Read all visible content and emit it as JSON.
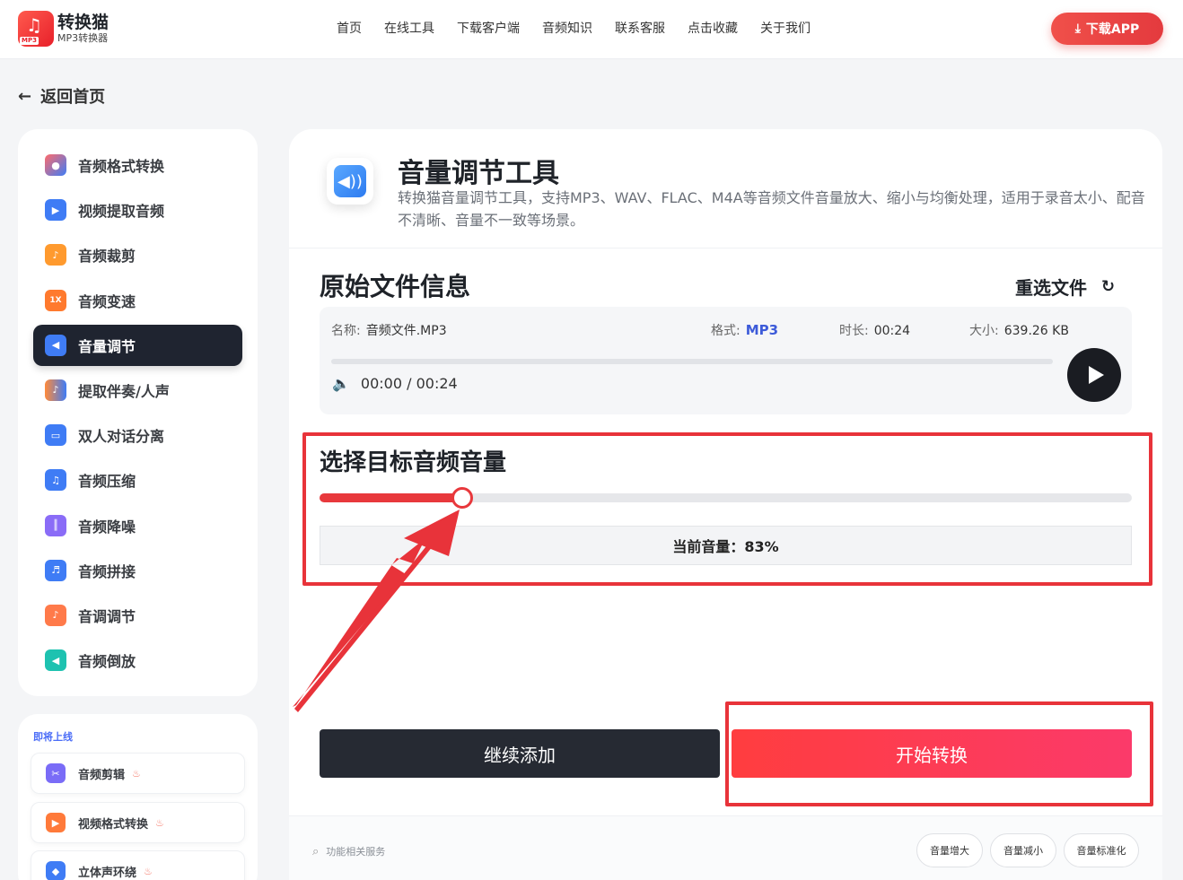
{
  "header": {
    "logo_title": "转换猫",
    "logo_sub": "MP3转换器",
    "logo_tag": "MP3",
    "nav": [
      "首页",
      "在线工具",
      "下载客户端",
      "音频知识",
      "联系客服",
      "点击收藏",
      "关于我们"
    ],
    "download_label": "下载APP"
  },
  "back_label": "返回首页",
  "sidebar": {
    "items": [
      {
        "label": "音频格式转换",
        "icon": "audio-format-icon",
        "color": "#ff6b6b"
      },
      {
        "label": "视频提取音频",
        "icon": "video-extract-icon",
        "color": "#3f7cf5"
      },
      {
        "label": "音频裁剪",
        "icon": "scissors-icon",
        "color": "#ff9a2e"
      },
      {
        "label": "音频变速",
        "icon": "speed-icon",
        "color": "#ff7a2e"
      },
      {
        "label": "音量调节",
        "icon": "volume-icon",
        "color": "#3f7cf5"
      },
      {
        "label": "提取伴奏/人声",
        "icon": "vocal-icon",
        "color": "#ff8a3a"
      },
      {
        "label": "双人对话分离",
        "icon": "dialog-icon",
        "color": "#3f7cf5"
      },
      {
        "label": "音频压缩",
        "icon": "compress-icon",
        "color": "#3f7cf5"
      },
      {
        "label": "音频降噪",
        "icon": "denoise-icon",
        "color": "#8a6cf7"
      },
      {
        "label": "音频拼接",
        "icon": "merge-icon",
        "color": "#3f7cf5"
      },
      {
        "label": "音调调节",
        "icon": "pitch-icon",
        "color": "#ff7a4a"
      },
      {
        "label": "音频倒放",
        "icon": "reverse-icon",
        "color": "#1ec2b0"
      }
    ],
    "active_index": 4
  },
  "soon": {
    "title": "即将上线",
    "items": [
      {
        "label": "音频剪辑",
        "color": "#7a6cf7"
      },
      {
        "label": "视频格式转换",
        "color": "#ff7a3a"
      },
      {
        "label": "立体声环绕",
        "color": "#3f7cf5"
      }
    ]
  },
  "tool": {
    "title": "音量调节工具",
    "desc": "转换猫音量调节工具，支持MP3、WAV、FLAC、M4A等音频文件音量放大、缩小与均衡处理，适用于录音太小、配音不清晰、音量不一致等场景。"
  },
  "file_info": {
    "section_title": "原始文件信息",
    "reselect_label": "重选文件",
    "name_key": "名称:",
    "name_value": "音频文件.MP3",
    "format_key": "格式:",
    "format_value": "MP3",
    "duration_key": "时长:",
    "duration_value": "00:24",
    "size_key": "大小:",
    "size_value": "639.26 KB",
    "time_readout": "00:00 / 00:24",
    "playback_progress": 0
  },
  "volume": {
    "section_title": "选择目标音频音量",
    "current_label": "当前音量：83%",
    "slider_fraction": 0.176
  },
  "actions": {
    "continue_label": "继续添加",
    "start_label": "开始转换"
  },
  "footer": {
    "label": "功能相关服务",
    "chips": [
      "音量增大",
      "音量减小",
      "音量标准化"
    ]
  },
  "colors": {
    "accent_red": "#e8383c",
    "dark": "#1f2430",
    "format_blue": "#3d5bd9"
  }
}
